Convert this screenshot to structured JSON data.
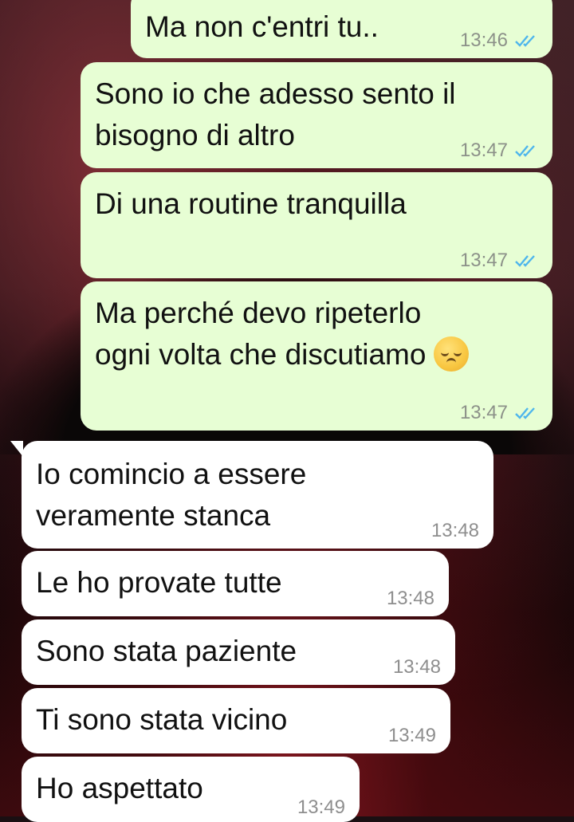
{
  "chat": {
    "messages": [
      {
        "dir": "out",
        "lines": [
          "Ma non c'entri tu.."
        ],
        "time": "13:46"
      },
      {
        "dir": "out",
        "lines": [
          "Sono io che adesso sento il",
          "bisogno di altro"
        ],
        "time": "13:47"
      },
      {
        "dir": "out",
        "lines": [
          "Di una routine tranquilla"
        ],
        "time": "13:47"
      },
      {
        "dir": "out",
        "lines": [
          "Ma perché devo ripeterlo",
          "ogni volta che discutiamo"
        ],
        "time": "13:47",
        "emoji": "pensive-face-emoji"
      },
      {
        "dir": "in",
        "lines": [
          "Io comincio a essere",
          "veramente stanca"
        ],
        "time": "13:48"
      },
      {
        "dir": "in",
        "lines": [
          "Le ho provate tutte"
        ],
        "time": "13:48"
      },
      {
        "dir": "in",
        "lines": [
          "Sono stata paziente"
        ],
        "time": "13:48"
      },
      {
        "dir": "in",
        "lines": [
          "Ti sono stata vicino"
        ],
        "time": "13:49"
      },
      {
        "dir": "in",
        "lines": [
          "Ho aspettato"
        ],
        "time": "13:49"
      }
    ]
  },
  "colors": {
    "outgoing_bubble": "#e7fed4",
    "incoming_bubble": "#ffffff",
    "read_ticks": "#4fb6ec",
    "timestamp": "#8c9189"
  },
  "icons": {
    "read_receipt": "double-check-icon"
  }
}
